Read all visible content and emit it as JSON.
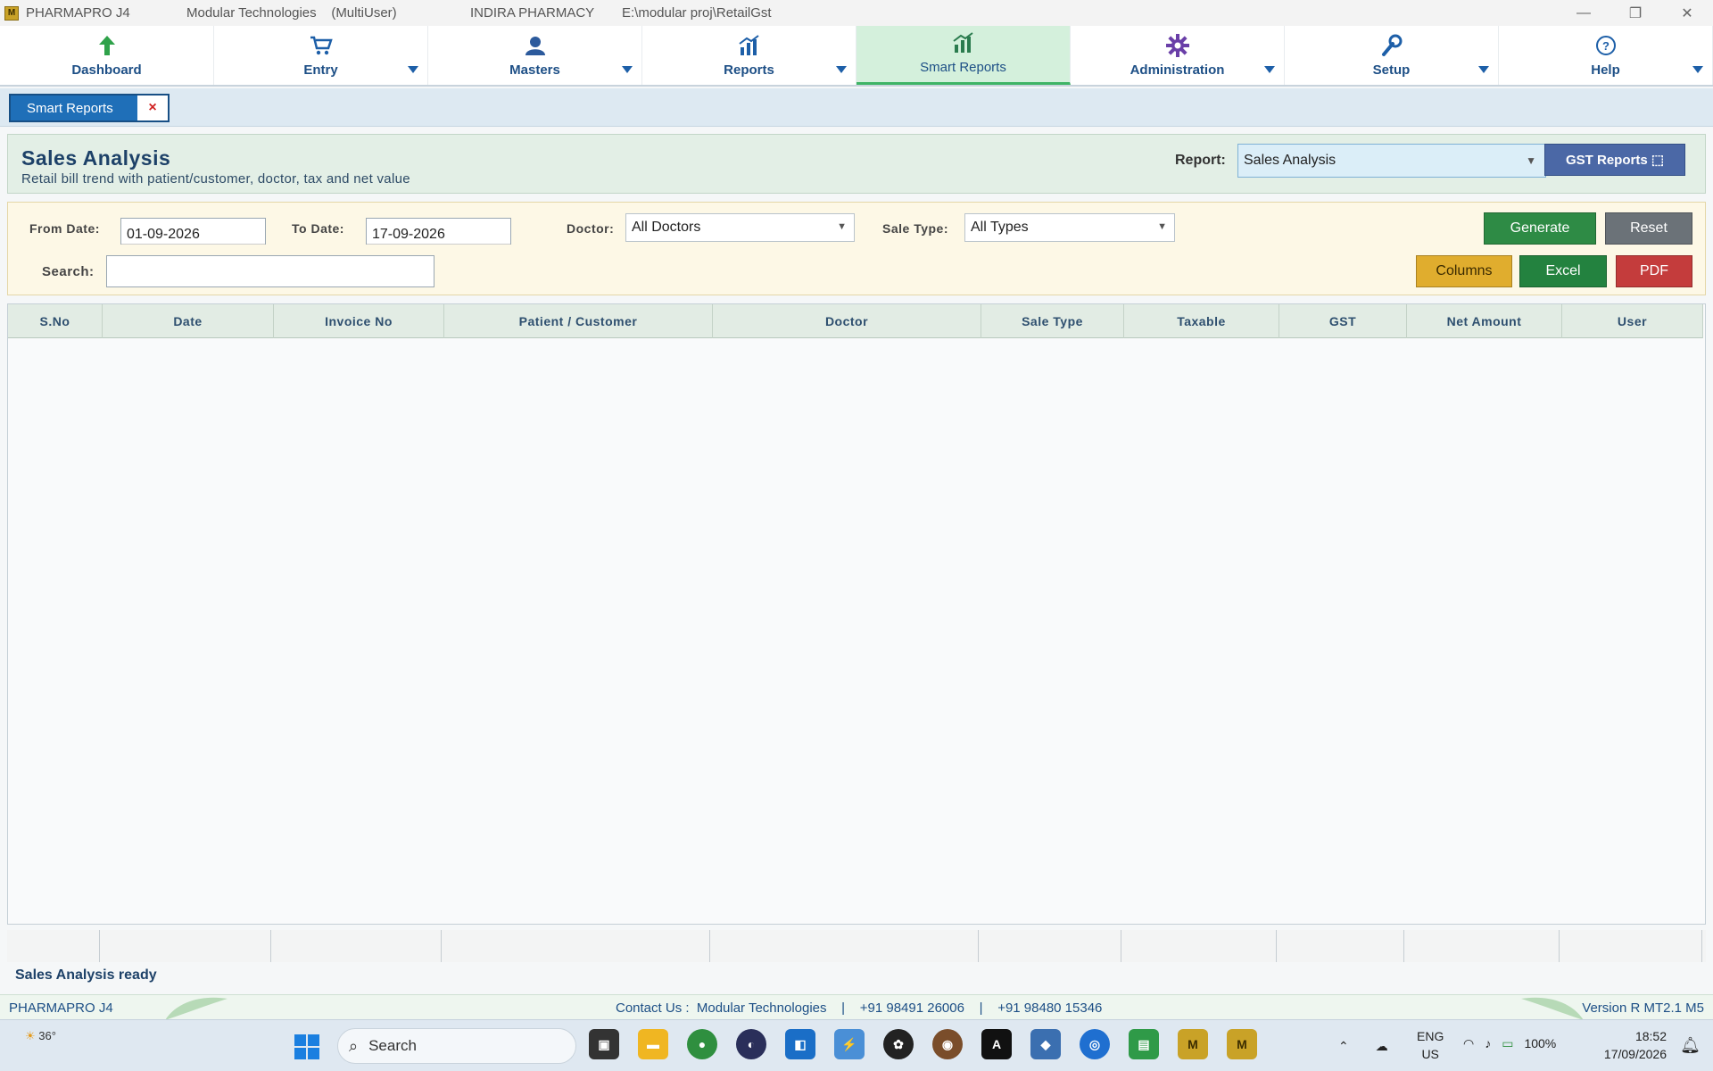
{
  "window": {
    "app_name": "PHARMAPRO J4",
    "company": "Modular Technologies    (MultiUser)",
    "pharmacy": "INDIRA PHARMACY",
    "path": "E:\\modular proj\\RetailGst",
    "controls": {
      "minimize": "—",
      "restore": "❐",
      "close": "✕"
    }
  },
  "menu": [
    {
      "label": "Dashboard",
      "icon": "up-arrow-icon",
      "has_dropdown": false
    },
    {
      "label": "Entry",
      "icon": "cart-icon",
      "has_dropdown": true
    },
    {
      "label": "Masters",
      "icon": "users-icon",
      "has_dropdown": true
    },
    {
      "label": "Reports",
      "icon": "bar-chart-icon",
      "has_dropdown": true
    },
    {
      "label": "Smart Reports",
      "icon": "bar-chart-icon",
      "has_dropdown": false,
      "active": true
    },
    {
      "label": "Administration",
      "icon": "gear-icon",
      "has_dropdown": true
    },
    {
      "label": "Setup",
      "icon": "wrench-icon",
      "has_dropdown": true
    },
    {
      "label": "Help",
      "icon": "help-circle-icon",
      "has_dropdown": true
    }
  ],
  "tabs": [
    {
      "label": "Smart Reports",
      "close": "×"
    }
  ],
  "header": {
    "title": "Sales Analysis",
    "subtitle": "Retail bill trend with patient/customer, doctor, tax and net value",
    "report_label": "Report:",
    "report_value": "Sales Analysis",
    "gst_button": "GST Reports ⬚"
  },
  "filters": {
    "from_label": "From Date:",
    "from_value": "01-09-2026",
    "to_label": "To Date:",
    "to_value": "17-09-2026",
    "doctor_label": "Doctor:",
    "doctor_value": "All Doctors",
    "sale_type_label": "Sale Type:",
    "sale_type_value": "All Types",
    "search_label": "Search:",
    "search_value": ""
  },
  "buttons": {
    "generate": "Generate",
    "reset": "Reset",
    "columns": "Columns",
    "excel": "Excel",
    "pdf": "PDF"
  },
  "grid": {
    "columns": [
      "S.No",
      "Date",
      "Invoice No",
      "Patient / Customer",
      "Doctor",
      "Sale Type",
      "Taxable",
      "GST",
      "Net Amount",
      "User"
    ],
    "rows": []
  },
  "status": "Sales Analysis ready",
  "infobar": {
    "left": "PHARMAPRO J4",
    "contact": "Contact Us :  Modular Technologies    |    +91 98491 26006    |    +91 98480 15346",
    "version": "Version R MT2.1 M5"
  },
  "taskbar": {
    "weather": "36°",
    "search_placeholder": "Search",
    "lang_top": "ENG",
    "lang_bottom": "US",
    "battery": "100%",
    "time": "18:52",
    "date": "17/09/2026"
  },
  "colors": {
    "accent": "#1d4f86",
    "active_menu": "#d4f0dc",
    "generate": "#2e8b45",
    "reset": "#6b7278",
    "columns": "#e0ad2e",
    "excel": "#23823f",
    "pdf": "#c43c3c",
    "gst": "#4b68a6"
  }
}
